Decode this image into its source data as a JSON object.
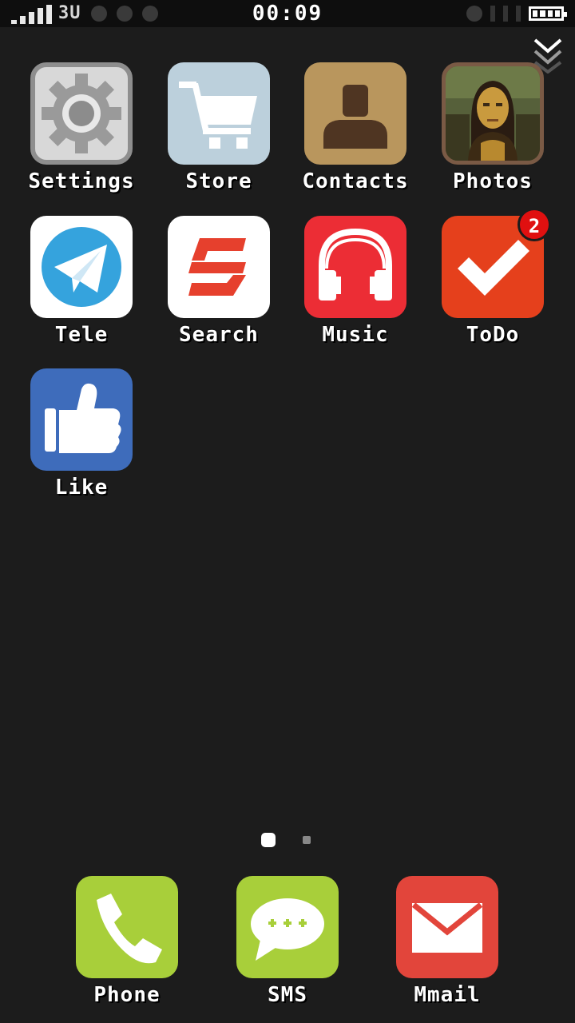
{
  "status_bar": {
    "network": "3U",
    "time": "00:09"
  },
  "apps": [
    {
      "name": "settings",
      "label": "Settings",
      "icon": "gear-icon",
      "color": "#c0c0c0"
    },
    {
      "name": "store",
      "label": "Store",
      "icon": "shopping-cart-icon",
      "color": "#bcd0dc"
    },
    {
      "name": "contacts",
      "label": "Contacts",
      "icon": "person-icon",
      "color": "#b9965d"
    },
    {
      "name": "photos",
      "label": "Photos",
      "icon": "mona-lisa-photo-icon",
      "color": "#5a3e2b"
    },
    {
      "name": "tele",
      "label": "Tele",
      "icon": "paper-plane-icon",
      "color": "#35a3dd"
    },
    {
      "name": "search",
      "label": "Search",
      "icon": "s-logo-icon",
      "color": "#e6402d"
    },
    {
      "name": "music",
      "label": "Music",
      "icon": "headphones-icon",
      "color": "#ec2d35"
    },
    {
      "name": "todo",
      "label": "ToDo",
      "icon": "checkmark-icon",
      "color": "#e5401c",
      "badge": "2"
    },
    {
      "name": "like",
      "label": "Like",
      "icon": "thumbs-up-icon",
      "color": "#3e6cbb"
    }
  ],
  "page_indicator": {
    "total": 2,
    "current": 1
  },
  "dock": [
    {
      "name": "phone",
      "label": "Phone",
      "icon": "phone-handset-icon",
      "color": "#a8cf3a"
    },
    {
      "name": "sms",
      "label": "SMS",
      "icon": "chat-bubble-icon",
      "color": "#a8cf3a"
    },
    {
      "name": "mmail",
      "label": "Mmail",
      "icon": "envelope-icon",
      "color": "#e2453b"
    }
  ]
}
